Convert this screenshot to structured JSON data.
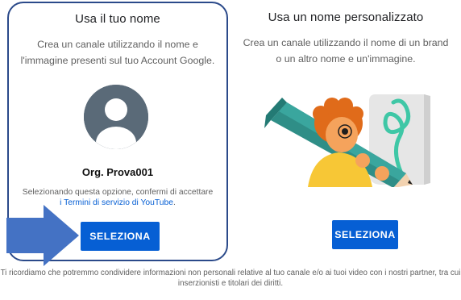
{
  "left_card": {
    "title": "Usa il tuo nome",
    "description": "Crea un canale utilizzando il nome e l'immagine presenti sul tuo Account Google.",
    "channel_name": "Org. Prova001",
    "terms_text": "Selezionando questa opzione, confermi di accettare",
    "terms_link": "i Termini di servizio di YouTube",
    "terms_end": ".",
    "button_label": "SELEZIONA"
  },
  "right_card": {
    "title": "Usa un nome personalizzato",
    "description": "Crea un canale utilizzando il nome di un brand o un altro nome e un'immagine.",
    "button_label": "SELEZIONA"
  },
  "footer": {
    "text": "Ti ricordiamo che potremmo condividere informazioni non personali relative al tuo canale e/o ai tuoi video con i nostri partner, tra cui inserzionisti e titolari dei diritti."
  },
  "colors": {
    "primary_button": "#065fd4",
    "highlight_border": "#2b4a8a",
    "arrow": "#4472c4",
    "link": "#065fd4"
  },
  "icons": {
    "avatar": "default-avatar-icon",
    "pointer": "arrow-right-icon",
    "illustration": "pencil-illustration"
  }
}
